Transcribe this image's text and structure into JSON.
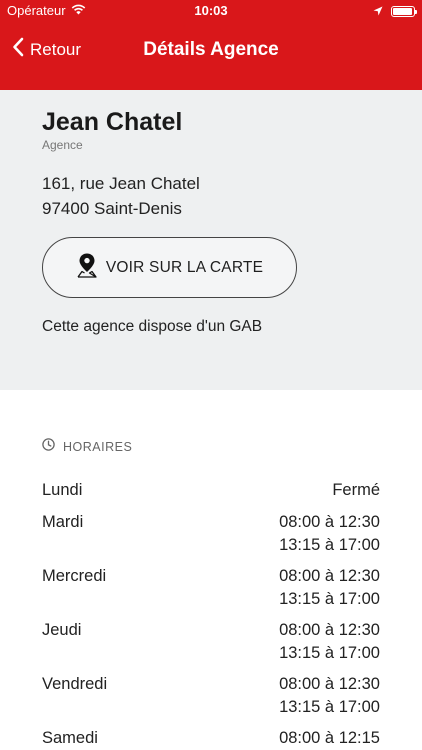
{
  "status": {
    "carrier": "Opérateur",
    "time": "10:03",
    "battery": 0.95
  },
  "nav": {
    "back_label": "Retour",
    "title": "Détails Agence"
  },
  "agency": {
    "name": "Jean Chatel",
    "type": "Agence",
    "address_line1": "161, rue Jean Chatel",
    "address_line2": "97400 Saint-Denis",
    "map_button_label": "VOIR SUR LA CARTE",
    "gab_note": "Cette agence dispose d'un GAB"
  },
  "hours": {
    "title": "HORAIRES",
    "days": [
      {
        "day": "Lundi",
        "slot1": "Fermé",
        "slot2": ""
      },
      {
        "day": "Mardi",
        "slot1": "08:00 à 12:30",
        "slot2": "13:15 à 17:00"
      },
      {
        "day": "Mercredi",
        "slot1": "08:00 à 12:30",
        "slot2": "13:15 à 17:00"
      },
      {
        "day": "Jeudi",
        "slot1": "08:00 à 12:30",
        "slot2": "13:15 à 17:00"
      },
      {
        "day": "Vendredi",
        "slot1": "08:00 à 12:30",
        "slot2": "13:15 à 17:00"
      },
      {
        "day": "Samedi",
        "slot1": "08:00 à 12:15",
        "slot2": ""
      }
    ]
  },
  "colors": {
    "brand": "#d9171a",
    "panel": "#eef0f1"
  }
}
